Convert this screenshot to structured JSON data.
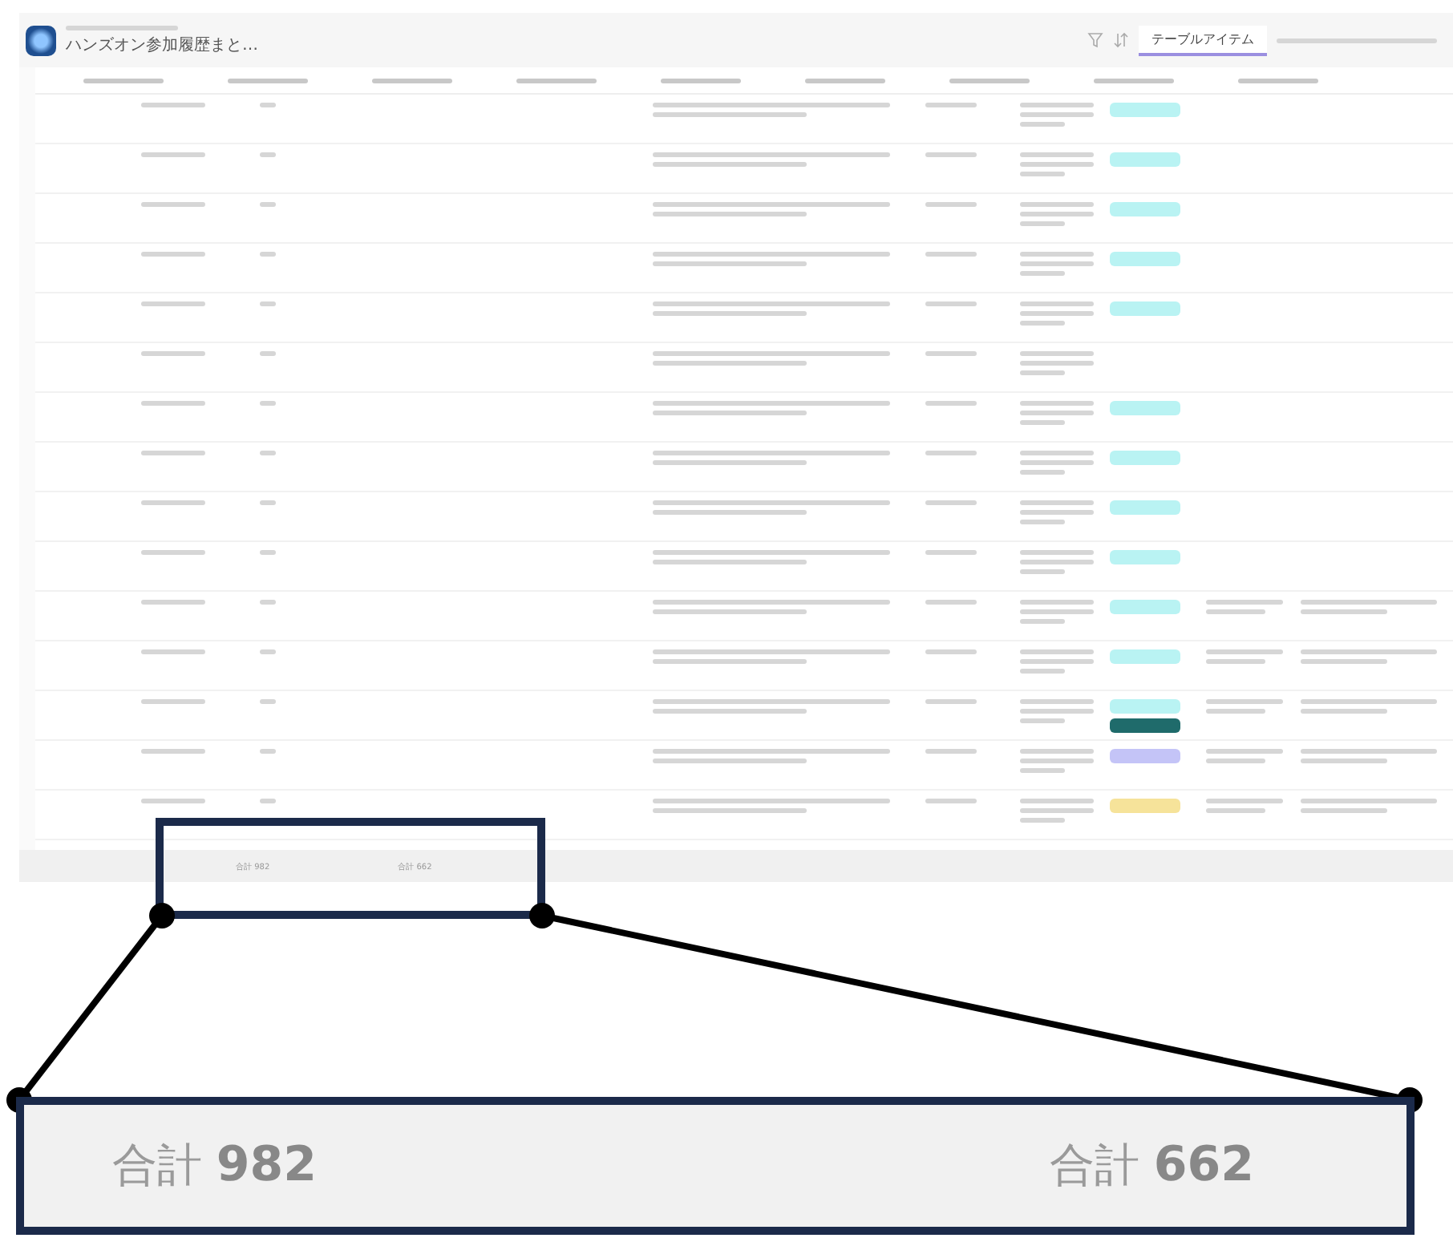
{
  "app": {
    "title": "ハンズオン参加履歴まと…",
    "view_tab": {
      "label": "テーブルアイテム",
      "selected": true
    }
  },
  "table": {
    "rows": [
      {
        "tags": [
          {
            "color": "#b9f3f3"
          }
        ],
        "extra": false
      },
      {
        "tags": [
          {
            "color": "#b9f3f3"
          }
        ],
        "extra": false
      },
      {
        "tags": [
          {
            "color": "#b9f3f3"
          }
        ],
        "extra": false
      },
      {
        "tags": [
          {
            "color": "#b9f3f3"
          }
        ],
        "extra": false
      },
      {
        "tags": [
          {
            "color": "#b9f3f3"
          }
        ],
        "extra": false
      },
      {
        "tags": [],
        "extra": false
      },
      {
        "tags": [
          {
            "color": "#b9f3f3"
          }
        ],
        "extra": false
      },
      {
        "tags": [
          {
            "color": "#b9f3f3"
          }
        ],
        "extra": false
      },
      {
        "tags": [
          {
            "color": "#b9f3f3"
          }
        ],
        "extra": false
      },
      {
        "tags": [
          {
            "color": "#b9f3f3"
          }
        ],
        "extra": false
      },
      {
        "tags": [
          {
            "color": "#b9f3f3"
          }
        ],
        "extra": true
      },
      {
        "tags": [
          {
            "color": "#b9f3f3"
          }
        ],
        "extra": true
      },
      {
        "tags": [
          {
            "color": "#b9f3f3"
          },
          {
            "color": "#1f6b6b"
          }
        ],
        "extra": true
      },
      {
        "tags": [
          {
            "color": "#c4c4f7"
          }
        ],
        "extra": true
      },
      {
        "tags": [
          {
            "color": "#f6e39a"
          }
        ],
        "extra": true
      }
    ],
    "footer_totals": [
      "合計 982",
      "合計 662"
    ]
  },
  "callout": {
    "totals": [
      {
        "label": "合計",
        "value": "982"
      },
      {
        "label": "合計",
        "value": "662"
      }
    ]
  }
}
